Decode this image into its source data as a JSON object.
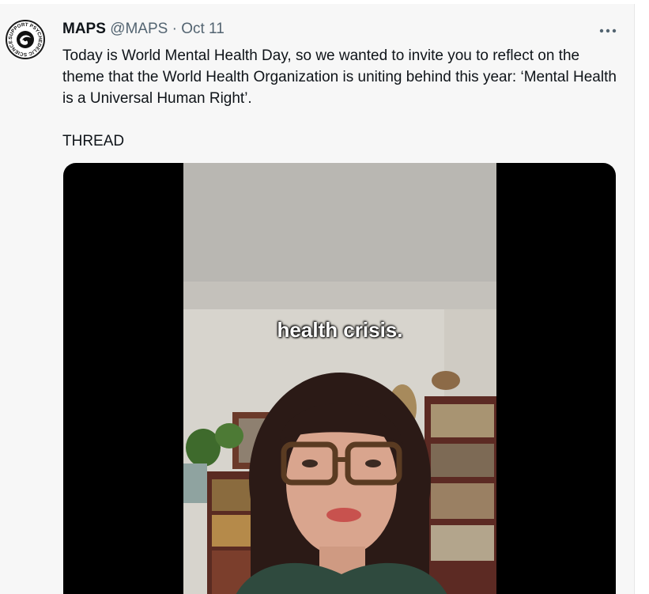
{
  "tweet": {
    "author_name": "MAPS",
    "handle": "@MAPS",
    "separator": "·",
    "date": "Oct 11",
    "avatar_icon": "maps-logo-icon",
    "avatar_text": "SUPPORT PSYCHEDELIC SCIENCE",
    "more_icon": "more-options-icon",
    "text_paragraph": "Today is World Mental Health Day, so we wanted to invite you to reflect on the theme that the World Health Organization is uniting behind this year: ‘Mental Health is a Universal Human Right’.",
    "thread_label": "THREAD"
  },
  "media": {
    "type": "video",
    "caption": "health crisis."
  },
  "colors": {
    "background": "#f7f7f7",
    "text_primary": "#0f1419",
    "text_secondary": "#536471",
    "media_background": "#000000"
  }
}
